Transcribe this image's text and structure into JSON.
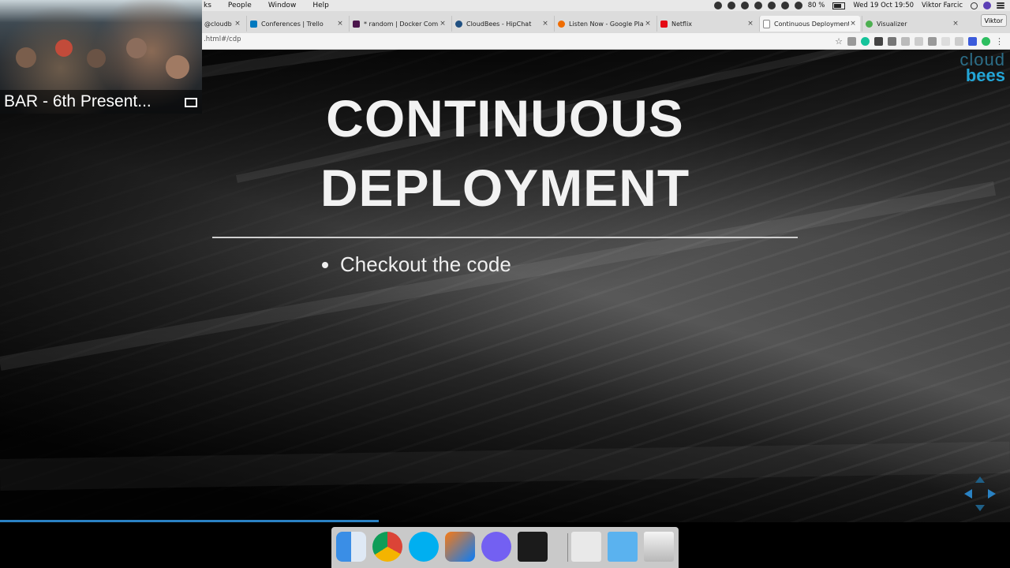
{
  "menubar": {
    "menus": [
      "ks",
      "People",
      "Window",
      "Help"
    ],
    "battery_pct": "80 %",
    "clock": "Wed 19 Oct  19:50",
    "user": "Viktor Farcic"
  },
  "tabs": [
    {
      "title": "@cloudb",
      "favicon_color": "#1da1f2"
    },
    {
      "title": "Conferences | Trello",
      "favicon_color": "#0079bf"
    },
    {
      "title": "* random | Docker Com",
      "favicon_color": "#4a154b"
    },
    {
      "title": "CloudBees - HipChat",
      "favicon_color": "#205081"
    },
    {
      "title": "Listen Now - Google Pla",
      "favicon_color": "#ef6c00"
    },
    {
      "title": "Netflix",
      "favicon_color": "#e50914"
    },
    {
      "title": "Continuous Deployment",
      "favicon_color": "#9e9e9e",
      "active": true
    },
    {
      "title": "Visualizer",
      "favicon_color": "#4caf50"
    }
  ],
  "profile_button": "Viktor",
  "address": ".html#/cdp",
  "slide": {
    "brand_line1": "cloud",
    "brand_line2": "bees",
    "title_line1": "CONTINUOUS",
    "title_line2": "DEPLOYMENT",
    "bullet": "Checkout the code",
    "progress_fraction": 0.375
  },
  "webcam": {
    "label": "BAR - 6th Present..."
  },
  "dock": {
    "apps": [
      "finder-icon",
      "chrome-icon",
      "skype-icon",
      "intellij-icon",
      "viber-icon",
      "terminal-icon",
      "preview-icon",
      "folder-icon",
      "trash-icon"
    ]
  },
  "colors": {
    "accent_blue": "#23a5d6",
    "progress": "#2a82c4"
  }
}
